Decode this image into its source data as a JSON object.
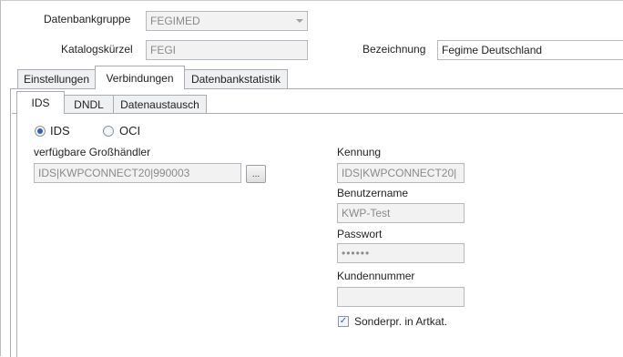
{
  "header": {
    "group_label": "Datenbankgruppe",
    "group_value": "FEGIMED",
    "short_label": "Katalogskürzel",
    "short_value": "FEGI",
    "name_label": "Bezeichnung",
    "name_value": "Fegime Deutschland"
  },
  "main_tabs": [
    "Einstellungen",
    "Verbindungen",
    "Datenbankstatistik"
  ],
  "sub_tabs": [
    "IDS",
    "DNDL",
    "Datenaustausch"
  ],
  "mode": {
    "option1": "IDS",
    "option2": "OCI",
    "selected": "IDS"
  },
  "wholesaler": {
    "label": "verfügbare Großhändler",
    "value": "IDS|KWPCONNECT20|990003",
    "browse_label": "..."
  },
  "credentials": {
    "id_label": "Kennung",
    "id_value": "IDS|KWPCONNECT20|",
    "user_label": "Benutzername",
    "user_value": "KWP-Test",
    "password_label": "Passwort",
    "password_value": "••••••",
    "customer_label": "Kundennummer",
    "customer_value": "",
    "special_price_label": "Sonderpr. in Artkat.",
    "special_price_checked": true
  }
}
